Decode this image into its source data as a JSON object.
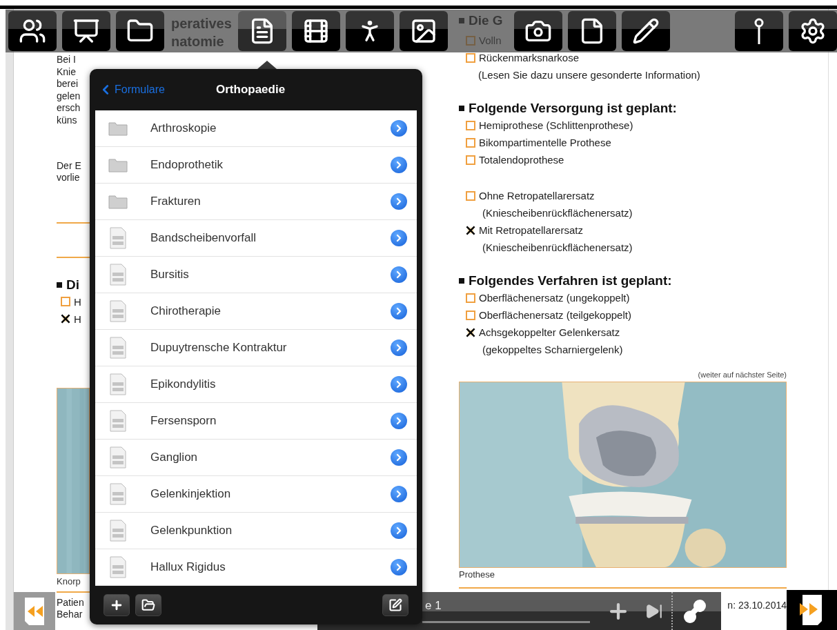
{
  "toolbar": {
    "buttons": [
      {
        "selected": false
      },
      {
        "selected": false
      },
      {
        "selected": false
      },
      {
        "selected": true
      },
      {
        "selected": false
      },
      {
        "selected": false
      },
      {
        "selected": false
      },
      {
        "selected": false
      },
      {
        "selected": false
      },
      {
        "selected": false
      },
      {
        "selected": false
      },
      {
        "selected": false
      }
    ]
  },
  "document": {
    "heading_left": [
      "peratives",
      "natomie"
    ],
    "left_column": {
      "lines": [
        "Bei I",
        "Knie",
        "berei",
        "gelen",
        "ersch",
        "küns"
      ],
      "lines_2": [
        "Der E",
        "vorlie"
      ],
      "heading": "Di",
      "options": [
        {
          "label": "H",
          "checked": false
        },
        {
          "label": "H",
          "checked": true
        }
      ],
      "caption": "Knorp",
      "footer": [
        "Patien",
        "Behar"
      ]
    },
    "right_column": {
      "sections": [
        {
          "heading": "Die G",
          "option_groups": [
            [
              {
                "label": "Volln",
                "checked": false
              },
              {
                "label": "Rückenmarksnarkose",
                "checked": false
              }
            ]
          ],
          "note": "(Lesen Sie dazu unsere gesonderte Information)"
        },
        {
          "heading": "Folgende Versorgung ist geplant:",
          "option_groups": [
            [
              {
                "label": "Hemiprothese (Schlittenprothese)",
                "checked": false
              },
              {
                "label": "Bikompartimentelle Prothese",
                "checked": false
              },
              {
                "label": "Totalendoprothese",
                "checked": false
              }
            ],
            [
              {
                "label": "Ohne Retropatellarersatz",
                "sublabel": "(Kniescheibenrückflächenersatz)",
                "checked": false
              },
              {
                "label": "Mit Retropatellarersatz",
                "sublabel": "(Kniescheibenrückflächenersatz)",
                "checked": true
              }
            ]
          ]
        },
        {
          "heading": "Folgendes Verfahren ist geplant:",
          "option_groups": [
            [
              {
                "label": "Oberflächenersatz (ungekoppelt)",
                "checked": false
              },
              {
                "label": "Oberflächenersatz (teilgekoppelt)",
                "checked": false
              },
              {
                "label": "Achsgekoppelter Gelenkersatz",
                "sublabel": "(gekoppeltes Scharniergelenk)",
                "checked": true
              }
            ]
          ]
        }
      ],
      "continue_note": "(weiter auf nächster Seite)",
      "caption": "Prothese",
      "date": "n: 23.10.2014"
    }
  },
  "popover": {
    "back": "Formulare",
    "title": "Orthopaedie",
    "items": [
      {
        "kind": "folder",
        "label": "Arthroskopie"
      },
      {
        "kind": "folder",
        "label": "Endoprothetik"
      },
      {
        "kind": "folder",
        "label": "Frakturen"
      },
      {
        "kind": "document",
        "label": "Bandscheibenvorfall"
      },
      {
        "kind": "document",
        "label": "Bursitis"
      },
      {
        "kind": "document",
        "label": "Chirotherapie"
      },
      {
        "kind": "document",
        "label": "Dupuytrensche Kontraktur"
      },
      {
        "kind": "document",
        "label": "Epikondylitis"
      },
      {
        "kind": "document",
        "label": "Fersensporn"
      },
      {
        "kind": "document",
        "label": "Ganglion"
      },
      {
        "kind": "document",
        "label": "Gelenkinjektion"
      },
      {
        "kind": "document",
        "label": "Gelenkpunktion"
      },
      {
        "kind": "document",
        "label": "Hallux Rigidus"
      }
    ]
  },
  "bottom_bar": {
    "page": "e 1"
  }
}
